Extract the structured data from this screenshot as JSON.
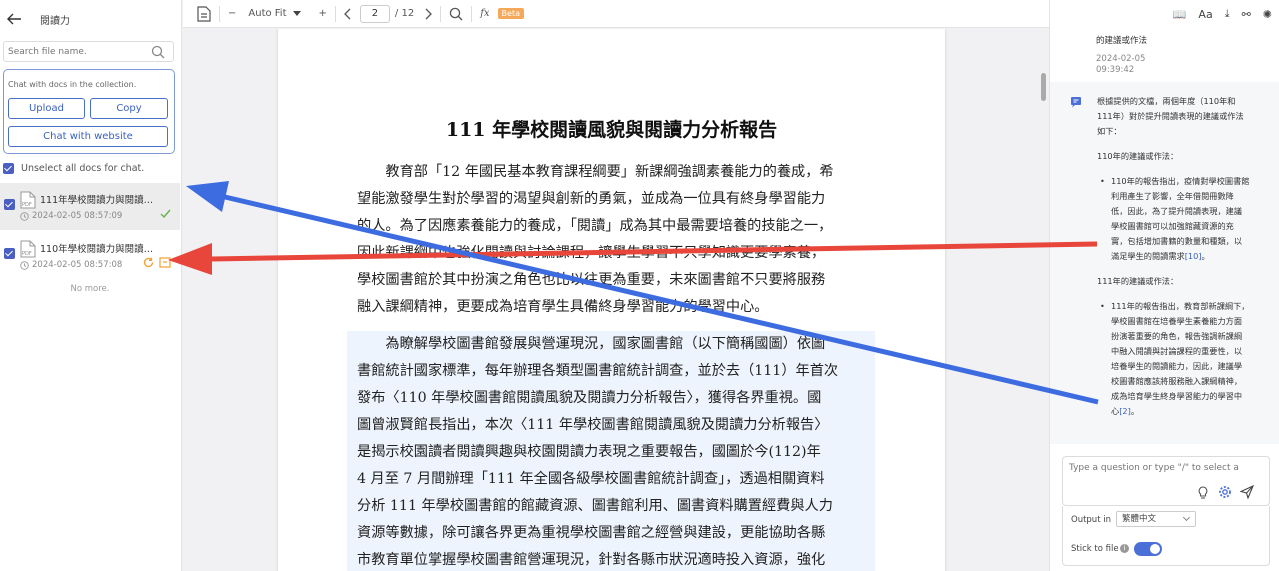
{
  "sidebar": {
    "collection_title": "閱讀力",
    "search_placeholder": "Search file name.",
    "chat_hint": "Chat with docs in the collection.",
    "upload_label": "Upload",
    "copy_label": "Copy",
    "website_label": "Chat with website",
    "unselect_label": "Unselect all docs for chat.",
    "docs": [
      {
        "name": "111年學校閱讀力與閱讀風貌分析報告.pdf",
        "time": "2024-02-05 08:57:09"
      },
      {
        "name": "110年學校閱讀力與閱讀風貌分析報告.pdf",
        "time": "2024-02-05 08:57:08"
      }
    ],
    "no_more": "No more."
  },
  "toolbar": {
    "zoom_minus": "−",
    "zoom_label": "Auto Fit",
    "zoom_plus": "+",
    "page_current": "2",
    "page_total": "/ 12",
    "fx_label": "fx",
    "beta_badge": "Beta"
  },
  "document": {
    "title": "111 年學校閱讀風貌與閱讀力分析報告",
    "para1": [
      "　　教育部「12 年國民基本教育課程綱要」新課綱強調素養能力的養成，希",
      "望能激發學生對於學習的渴望與創新的勇氣，並成為一位具有終身學習能力",
      "的人。為了因應素養能力的養成，「閱讀」成為其中最需要培養的技能之一，",
      "因此新課綱中也強化閱讀與討論課程，讓學生學習不只學知識更要學素養，",
      "學校圖書館於其中扮演之角色也比以往更為重要，未來圖書館不只要將服務",
      "融入課綱精神，更要成為培育學生具備終身學習能力的學習中心。"
    ],
    "para2": [
      "　　為瞭解學校圖書館發展與營運現況，國家圖書館（以下簡稱國圖）依圖",
      "書館統計國家標準，每年辦理各類型圖書館統計調查，並於去（111）年首次",
      "發布〈110 年學校圖書館閱讀風貌及閱讀力分析報告〉，獲得各界重視。國",
      "圖曾淑賢館長指出，本次〈111 年學校圖書館閱讀風貌及閱讀力分析報告〉",
      "是揭示校園讀者閱讀興趣與校園閱讀力表現之重要報告，國圖於今(112)年",
      "4 月至 7 月間辦理「111 年全國各級學校圖書館統計調查」，透過相關資料",
      "分析 111 年學校圖書館的館藏資源、圖書館利用、圖書資料購置經費與人力",
      "資源等數據，除可讓各界更為重視學校圖書館之經營與建設，更能協助各縣",
      "市教育單位掌握學校圖書館營運現況，針對各縣市狀況適時投入資源，強化"
    ]
  },
  "chat": {
    "prev_message": "的建議或作法",
    "prev_time": "2024-02-05 09:39:42",
    "answer_intro": [
      "根據提供的文檔，兩個年度（110年和",
      "111年）對於提升閱讀表現的建議或作法",
      "如下："
    ],
    "section1_title": "110年的建議或作法：",
    "section1_lines": [
      "110年的報告指出，疫情對學校圖書館",
      "利用產生了影響，全年借閱冊數降",
      "低，因此，為了提升閱讀表現，建議",
      "學校圖書館可以加強館藏資源的充",
      "實，包括增加書籍的數量和種類，以",
      "滿足學生的閱讀需求"
    ],
    "section1_ref": "[10]",
    "section1_end": "。",
    "section2_title": "111年的建議或作法：",
    "section2_lines": [
      "111年的報告指出，教育部新課綱下，",
      "學校圖書館在培養學生素養能力方面",
      "扮演著重要的角色，報告強調新課綱",
      "中融入閱讀與討論課程的重要性，以",
      "培養學生的閱讀能力，因此，建議學",
      "校圖書館應該將服務融入課綱精神，",
      "成為培育學生終身學習能力的學習中"
    ],
    "section2_last": "心",
    "section2_ref": "[2]",
    "section2_end": "。",
    "input_placeholder": "Type a question or type \"/\" to select a",
    "output_label": "Output in",
    "output_lang": "繁體中文",
    "stick_label": "Stick to file",
    "info_mark": "i",
    "toolbar_icons": [
      "book-icon",
      "font-icon",
      "download-icon",
      "share-icon",
      "openai-icon"
    ],
    "toolbar_glyphs": [
      "📖",
      "Aa",
      "⤓",
      "⚯",
      "✺"
    ]
  },
  "colors": {
    "accent": "#4a6fd6",
    "arrow_red": "#e8463a",
    "arrow_blue": "#3d6be0",
    "beta": "#f5a85a"
  }
}
